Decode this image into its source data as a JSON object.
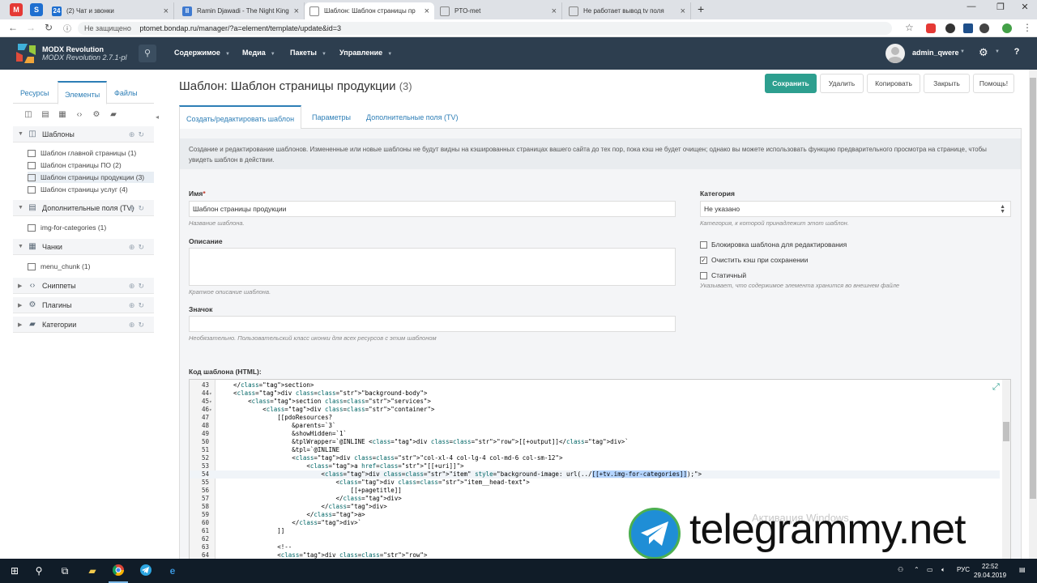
{
  "browser": {
    "pinned_tabs": [
      {
        "icon": "modx-pinned-icon",
        "color": "#e53935",
        "glyph": "M"
      },
      {
        "icon": "s-pinned-icon",
        "color": "#1e6fd0",
        "glyph": "S"
      }
    ],
    "tabs": [
      {
        "title": "(2) Чат и звонки",
        "badge": "24",
        "color": "#1e6fd0"
      },
      {
        "title": "Ramin Djawadi - The Night King",
        "badge": "II",
        "color": "#3f7ad0"
      },
      {
        "title": "Шаблон: Шаблон страницы пр",
        "badge": "",
        "color": "#ffffff"
      },
      {
        "title": "PTO-met",
        "badge": "",
        "color": "#ffffff"
      },
      {
        "title": "Не работает вывод tv поля",
        "badge": "",
        "color": "#ffffff"
      }
    ],
    "address": {
      "security": "Не защищено",
      "url": "ptomet.bondap.ru/manager/?a=element/template/update&id=3"
    }
  },
  "modx": {
    "brand": "MODX Revolution",
    "version": "MODX Revolution 2.7.1-pl",
    "menu": [
      "Содержимое",
      "Медиа",
      "Пакеты",
      "Управление"
    ],
    "user": "admin_qwere",
    "accent": "#2d9f8f",
    "nav_bg": "#2d3e4f"
  },
  "sidebar": {
    "tabs": [
      "Ресурсы",
      "Элементы",
      "Файлы"
    ],
    "active_tab": "Элементы",
    "groups": [
      {
        "label": "Шаблоны",
        "icon": "template-icon",
        "items": [
          "Шаблон главной страницы (1)",
          "Шаблон страницы ПО (2)",
          "Шаблон страницы продукции (3)",
          "Шаблон страницы услуг (4)"
        ]
      },
      {
        "label": "Дополнительные поля (TV)",
        "icon": "tv-icon",
        "items": [
          "img-for-categories (1)"
        ]
      },
      {
        "label": "Чанки",
        "icon": "chunk-icon",
        "items": [
          "menu_chunk (1)"
        ]
      },
      {
        "label": "Сниппеты",
        "icon": "code-icon",
        "items": []
      },
      {
        "label": "Плагины",
        "icon": "plugin-gear-icon",
        "items": []
      },
      {
        "label": "Категории",
        "icon": "folder-icon",
        "items": []
      }
    ]
  },
  "main": {
    "title": "Шаблон: Шаблон страницы продукции",
    "id_count": "(3)",
    "buttons": [
      "Сохранить",
      "Удалить",
      "Копировать",
      "Закрыть",
      "Помощь!"
    ],
    "tabs": [
      "Создать/редактировать шаблон",
      "Параметры",
      "Дополнительные поля (TV)"
    ],
    "description": "Создание и редактирование шаблонов. Измененные или новые шаблоны не будут видны на кэшированных страницах вашего сайта до тех пор, пока кэш не будет очищен; однако вы можете использовать функцию предварительного просмотра на странице, чтобы увидеть шаблон в действии.",
    "form": {
      "name_label": "Имя",
      "name_value": "Шаблон страницы продукции",
      "name_hint": "Название шаблона.",
      "desc_label": "Описание",
      "desc_hint": "Краткое описание шаблона.",
      "icon_label": "Значок",
      "icon_hint": "Необязательно. Пользовательский класс иконки для всех ресурсов с этим шаблоном",
      "category_label": "Категория",
      "category_value": "Не указано",
      "category_hint": "Категория, к которой принадлежит этот шаблон.",
      "lock_label": "Блокировка шаблона для редактирования",
      "lock_checked": false,
      "clear_cache_label": "Очистить кэш при сохранении",
      "clear_cache_checked": true,
      "static_label": "Статичный",
      "static_checked": false,
      "static_hint": "Указывает, что содержимое элемента хранится во внешнем файле",
      "code_label": "Код шаблона (HTML):"
    },
    "code_lines": [
      {
        "n": "43",
        "fold": "",
        "text": "    </section>"
      },
      {
        "n": "44",
        "fold": "▾",
        "text": "    <div class=\"background-body\">"
      },
      {
        "n": "45",
        "fold": "▾",
        "text": "        <section class=\"services\">"
      },
      {
        "n": "46",
        "fold": "▾",
        "text": "            <div class=\"container\">"
      },
      {
        "n": "47",
        "fold": "",
        "text": "                [[pdoResources?"
      },
      {
        "n": "48",
        "fold": "",
        "text": "                    &parents=`3`"
      },
      {
        "n": "49",
        "fold": "",
        "text": "                    &showHidden=`1`"
      },
      {
        "n": "50",
        "fold": "",
        "text": "                    &tplWrapper=`@INLINE <div class=\"row\">[[+output]]</div>`"
      },
      {
        "n": "51",
        "fold": "",
        "text": "                    &tpl=`@INLINE"
      },
      {
        "n": "52",
        "fold": "",
        "text": "                    <div class=\"col-xl-4 col-lg-4 col-md-6 col-sm-12\">"
      },
      {
        "n": "53",
        "fold": "",
        "text": "                        <a href=\"[[+uri]]\">"
      },
      {
        "n": "54",
        "fold": "",
        "text": "                            <div class=\"item\" style=\"background-image: url(../[[+tv.img-for-categories]]);\">",
        "highlight": "[[+tv.img-for-categories]]"
      },
      {
        "n": "55",
        "fold": "",
        "text": "                                <div class=\"item__head-text\">"
      },
      {
        "n": "56",
        "fold": "",
        "text": "                                    [[+pagetitle]]"
      },
      {
        "n": "57",
        "fold": "",
        "text": "                                </div>"
      },
      {
        "n": "58",
        "fold": "",
        "text": "                            </div>"
      },
      {
        "n": "59",
        "fold": "",
        "text": "                        </a>"
      },
      {
        "n": "60",
        "fold": "",
        "text": "                    </div>`"
      },
      {
        "n": "61",
        "fold": "",
        "text": "                ]]"
      },
      {
        "n": "62",
        "fold": "",
        "text": ""
      },
      {
        "n": "63",
        "fold": "",
        "text": "                <!--"
      },
      {
        "n": "64",
        "fold": "",
        "text": "                <div class=\"row\">"
      }
    ]
  },
  "overlay": {
    "activation": "Активация Windows",
    "watermark": "telegrammy.net"
  },
  "taskbar": {
    "lang": "РУС",
    "time": "22:52",
    "date": "29.04.2019"
  }
}
